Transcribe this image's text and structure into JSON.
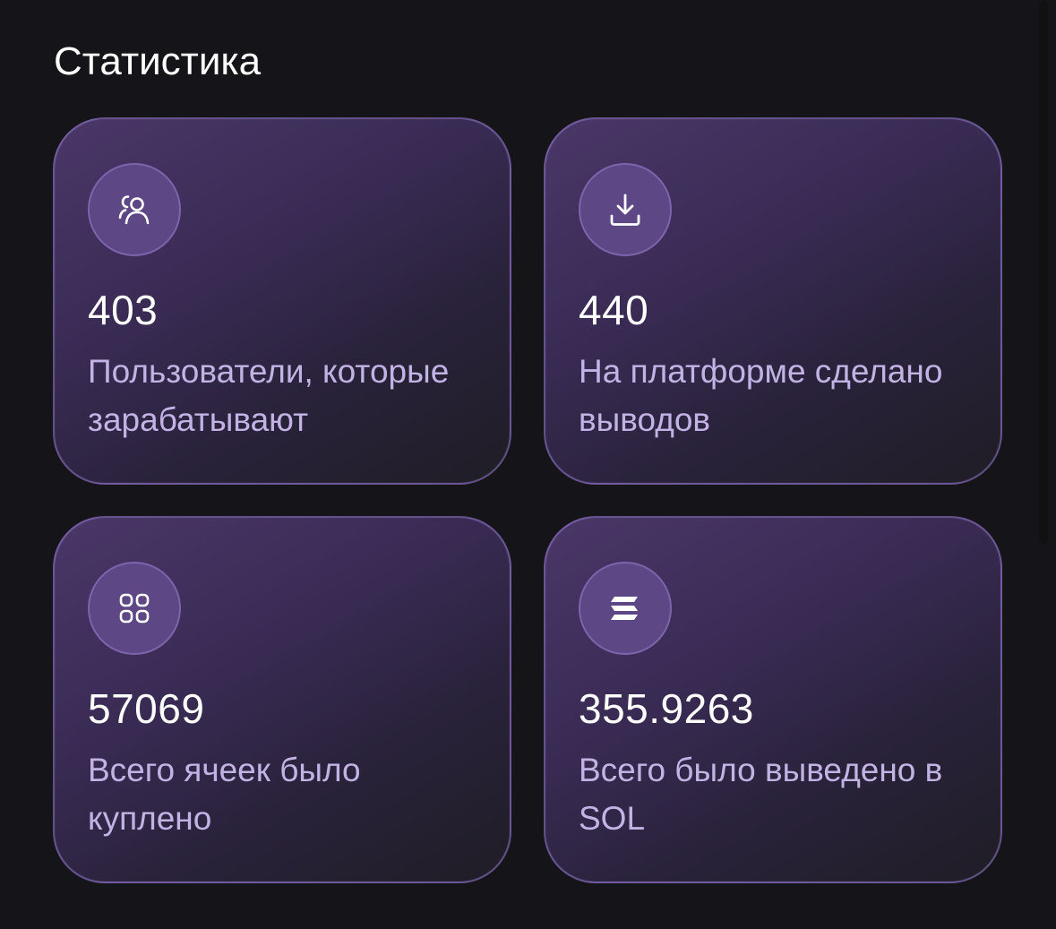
{
  "section": {
    "title": "Статистика"
  },
  "stats": [
    {
      "icon": "users-icon",
      "value": "403",
      "label": "Пользователи, которые зарабатывают"
    },
    {
      "icon": "download-icon",
      "value": "440",
      "label": "На платформе сделано выводов"
    },
    {
      "icon": "grid-icon",
      "value": "57069",
      "label": "Всего ячеек было куплено"
    },
    {
      "icon": "solana-icon",
      "value": "355.9263",
      "label": "Всего было выведено в SOL"
    }
  ],
  "colors": {
    "background": "#151519",
    "card_gradient_start": "#4a3768",
    "card_gradient_end": "#1f1d25",
    "card_border": "#967ad2",
    "icon_circle": "#5d4885",
    "icon_circle_border": "#7d65ac",
    "value_text": "#ffffff",
    "label_text": "#c2b3e4"
  }
}
